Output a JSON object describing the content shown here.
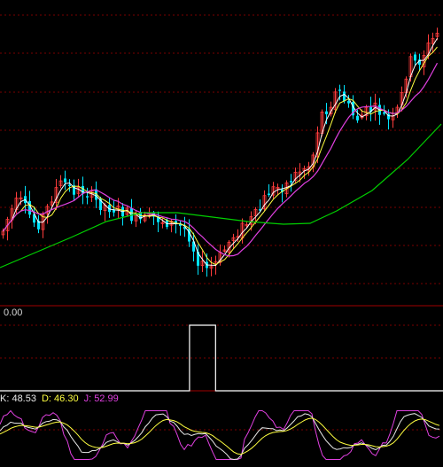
{
  "colors": {
    "background": "#000000",
    "up": "#ff3c3c",
    "down": "#00e5ff",
    "grid": "#7a0000",
    "border": "#a00000",
    "ma_short": "#ffffff",
    "ma_mid": "#ffff40",
    "ma_long": "#e040e0",
    "ma_xlong": "#00d000",
    "kdj_k": "#e8e8e8",
    "kdj_d": "#ffff40",
    "kdj_j": "#e040e0"
  },
  "volume_panel": {
    "value_text": "0.00",
    "pulse": [
      0,
      0,
      0,
      0,
      0,
      0,
      0,
      0,
      0,
      0,
      0,
      0,
      0,
      0,
      0,
      0,
      0,
      0,
      0,
      0,
      0,
      0,
      0,
      0,
      0,
      0,
      0,
      0,
      0,
      0,
      0,
      0,
      0,
      0,
      0,
      0,
      0,
      0,
      0,
      0,
      0,
      0,
      0,
      0,
      0,
      0,
      0,
      0,
      0,
      0,
      0,
      0,
      0,
      0,
      0,
      0,
      0,
      0,
      0,
      0,
      0,
      0,
      0,
      0,
      0,
      0,
      0,
      0,
      0,
      0,
      0,
      0,
      0,
      0,
      0,
      0,
      0,
      0,
      0,
      0,
      1,
      1,
      1,
      1,
      1,
      1,
      1,
      1,
      1,
      1,
      1,
      0,
      0,
      0,
      0,
      0,
      0,
      0,
      0,
      0,
      0,
      0,
      0,
      0,
      0,
      0,
      0,
      0,
      0,
      0,
      0,
      0,
      0,
      0,
      0,
      0,
      0,
      0,
      0,
      0,
      0,
      0,
      0,
      0,
      0,
      0,
      0,
      0,
      0,
      0,
      0,
      0,
      0,
      0,
      0,
      0,
      0,
      0,
      0,
      0,
      0,
      0,
      0,
      0,
      0,
      0,
      0,
      0,
      0,
      0,
      0,
      0,
      0,
      0,
      0,
      0,
      0,
      0,
      0,
      0,
      0,
      0,
      0,
      0,
      0,
      0,
      0,
      0,
      0,
      0,
      0,
      0,
      0,
      0,
      0,
      0,
      0,
      0,
      0,
      0,
      0,
      0,
      0,
      0,
      0,
      0,
      0,
      0
    ]
  },
  "kdj_panel": {
    "k_label": "K: 48.53",
    "d_label": "D: 46.30",
    "j_label": "J: 52.99"
  }
}
